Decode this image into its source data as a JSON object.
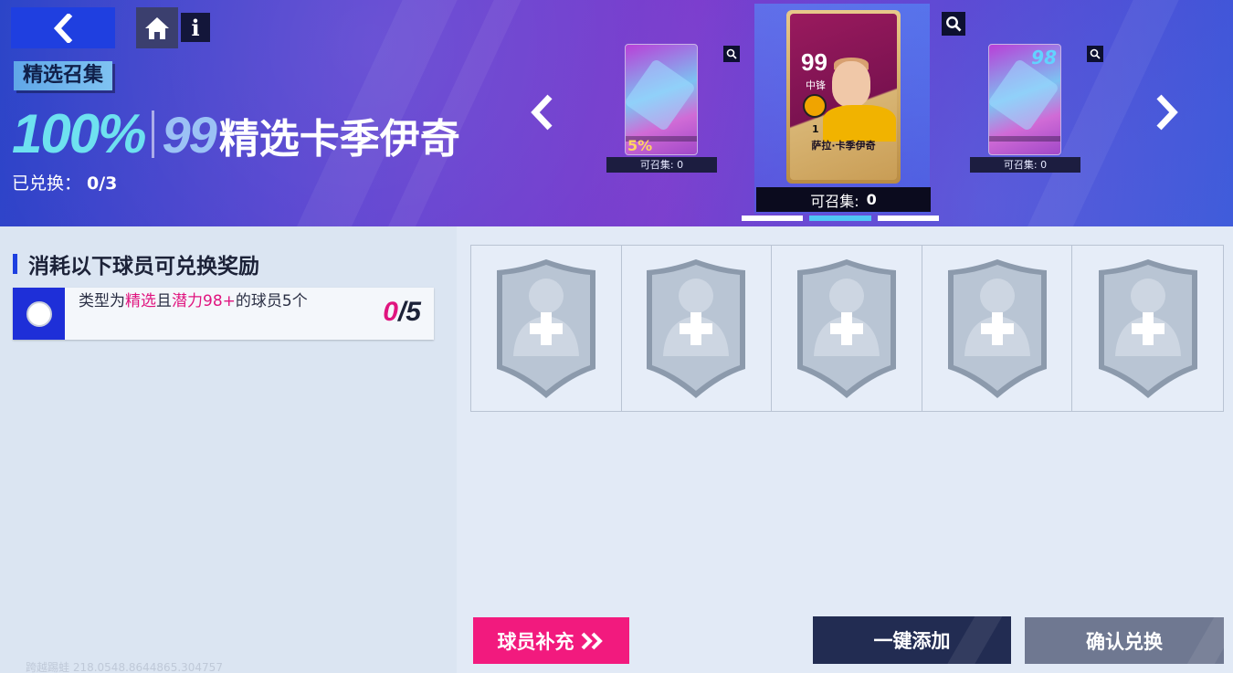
{
  "header": {
    "tag_label": "精选召集",
    "title_percent": "100%",
    "title_rating": "99",
    "title_name": "精选卡季伊奇",
    "redeemed_label": "已兑换：",
    "redeemed_value": "0/3"
  },
  "carousel": {
    "left_card": {
      "count_label": "可召集:  0",
      "badge": "5%"
    },
    "center_card": {
      "rating": "99",
      "position": "中锋",
      "number": "1",
      "player_name": "萨拉·卡季伊奇",
      "count_label": "可召集:",
      "count_value": "0"
    },
    "right_card": {
      "count_label": "可召集:  0",
      "rating": "98"
    }
  },
  "requirements": {
    "title": "消耗以下球员可兑换奖励",
    "item": {
      "text_prefix": "类型为",
      "text_hl1": "精选",
      "text_mid": "且",
      "text_hl2": "潜力98+",
      "text_suffix": "的球员5个",
      "progress_current": "0",
      "progress_total": "/5"
    }
  },
  "slots": {
    "count": 5
  },
  "buttons": {
    "supply": "球员补充",
    "auto_add": "一键添加",
    "confirm": "确认兑换"
  },
  "watermark": "跨越踢蛙  218.0548.8644865.304757",
  "colors": {
    "accent_blue": "#1e40e0",
    "accent_pink": "#f21a7e",
    "button_dark": "#222c52",
    "button_gray": "#6f7891"
  }
}
